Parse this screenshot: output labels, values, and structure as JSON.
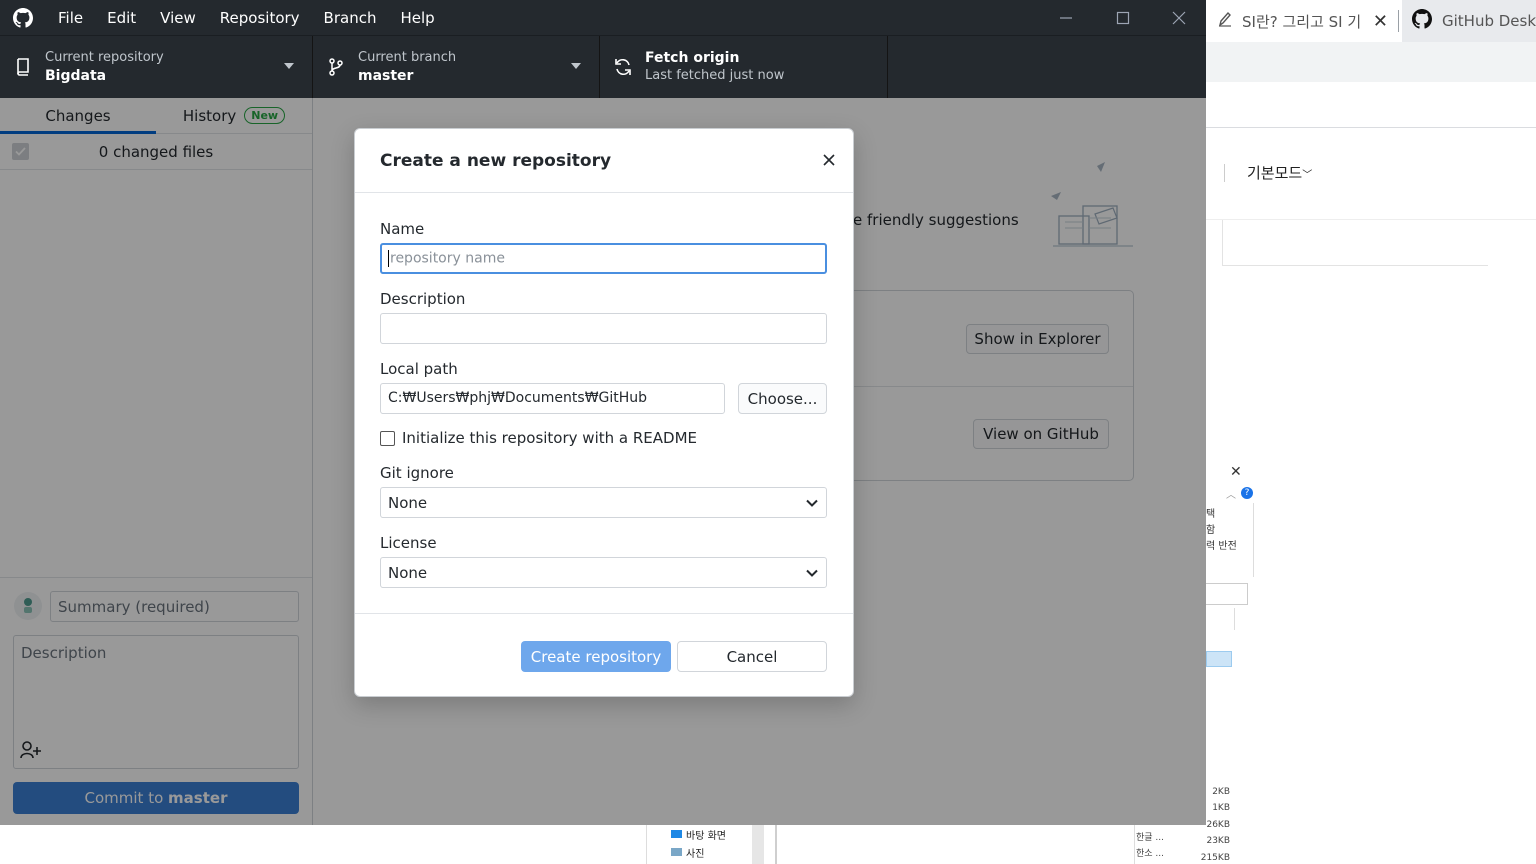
{
  "menu": {
    "file": "File",
    "edit": "Edit",
    "view": "View",
    "repository": "Repository",
    "branch": "Branch",
    "help": "Help"
  },
  "toolbar": {
    "repo_label": "Current repository",
    "repo_value": "Bigdata",
    "branch_label": "Current branch",
    "branch_value": "master",
    "fetch_label": "Fetch origin",
    "fetch_status": "Last fetched just now"
  },
  "sidebar": {
    "tab_changes": "Changes",
    "tab_history": "History",
    "badge_new": "New",
    "changed_files": "0 changed files",
    "summary_placeholder": "Summary (required)",
    "description_placeholder": "Description",
    "commit_prefix": "Commit to ",
    "commit_branch": "master"
  },
  "main": {
    "suggestions_text": "e friendly suggestions",
    "show_in_explorer": "Show in Explorer",
    "view_on_github": "View on GitHub"
  },
  "dialog": {
    "title": "Create a new repository",
    "name_label": "Name",
    "name_placeholder": "repository name",
    "description_label": "Description",
    "local_path_label": "Local path",
    "local_path_value": "C:₩Users₩phj₩Documents₩GitHub",
    "choose_label": "Choose...",
    "readme_label": "Initialize this repository with a README",
    "gitignore_label": "Git ignore",
    "gitignore_value": "None",
    "license_label": "License",
    "license_value": "None",
    "create_label": "Create repository",
    "cancel_label": "Cancel"
  },
  "background": {
    "tab1_title": "SI란? 그리고 SI 기",
    "tab2_title": "GitHub Deskto",
    "mode_label": "기본모드",
    "panel_lines": [
      "택",
      "함",
      "력 반전"
    ],
    "sizes": [
      "2KB",
      "1KB",
      "26KB",
      "23KB",
      "215KB"
    ],
    "files": [
      "한글 ...",
      "한소 ..."
    ],
    "explorer_items": [
      "바탕 화면",
      "사진"
    ]
  },
  "colors": {
    "titlebar": "#24292e",
    "accent": "#0366d6",
    "primary_button": "#6ea7ec",
    "commit_button": "#3b7fd4",
    "badge_green": "#28a745"
  }
}
